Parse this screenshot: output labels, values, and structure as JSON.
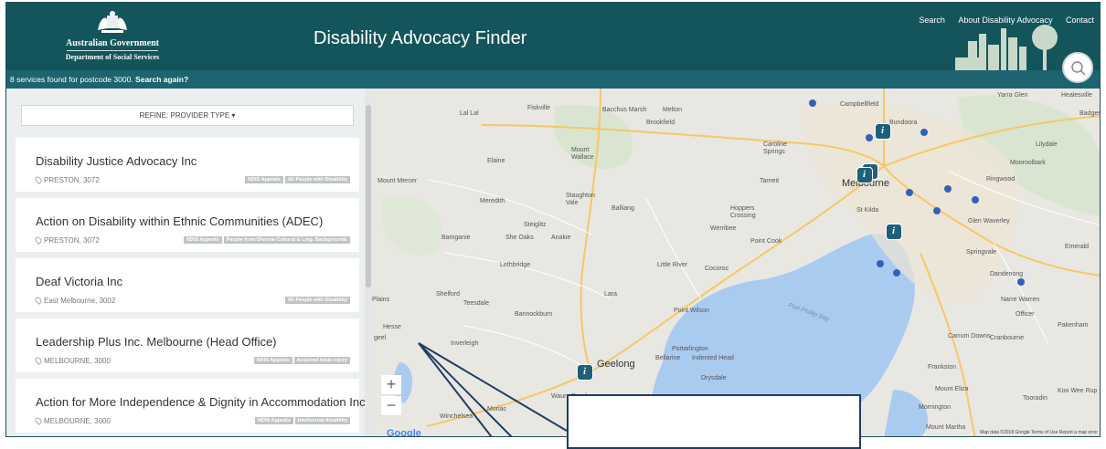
{
  "header": {
    "gov_name": "Australian Government",
    "dept_name": "Department of Social Services",
    "app_title": "Disability Advocacy Finder",
    "links": [
      "Search",
      "About Disability Advocacy",
      "Contact"
    ]
  },
  "status": {
    "found_text": "8 services found for postcode 3000.",
    "search_again": "Search again?"
  },
  "refine": {
    "label": "REFINE: PROVIDER TYPE ▾"
  },
  "services": [
    {
      "name": "Disability Justice Advocacy Inc",
      "location": "PRESTON, 3072",
      "tags": [
        "NDIS Appeals",
        "All People with Disability"
      ]
    },
    {
      "name": "Action on Disability within Ethnic Communities (ADEC)",
      "location": "PRESTON, 3072",
      "tags": [
        "NDIS Appeals",
        "People from Diverse Cultural & Ling. Backgrounds"
      ]
    },
    {
      "name": "Deaf Victoria Inc",
      "location": "East Melbourne, 3002",
      "tags": [
        "All People with Disability"
      ]
    },
    {
      "name": "Leadership Plus Inc. Melbourne (Head Office)",
      "location": "MELBOURNE, 3000",
      "tags": [
        "NDIS Appeals",
        "Acquired brain injury"
      ]
    },
    {
      "name": "Action for More Independence & Dignity in Accommodation Inc",
      "location": "MELBOURNE, 3000",
      "tags": [
        "NDIS Appeals",
        "Intellectual disability"
      ]
    }
  ],
  "map": {
    "places": [
      "Lal Lal",
      "Fiskville",
      "Bacchus Marsh",
      "Melton",
      "Brookfield",
      "Campbellfield",
      "Bundoora",
      "Mount Wallace",
      "Elaine",
      "Caroline Springs",
      "Mount Mercer",
      "Meredith",
      "Staughton Vale",
      "Tarneit",
      "Melbourne",
      "Ringwood",
      "Mooroolbark",
      "Lilydale",
      "Balliang",
      "Hoppers Crossing",
      "St Kilda",
      "Glen Waverley",
      "Steiglitz",
      "She Oaks",
      "Anakie",
      "Werribee",
      "Point Cook",
      "Bamganie",
      "Lethbridge",
      "Little River",
      "Cocoroc",
      "Springvale",
      "Dandenong",
      "Emerald",
      "Shelford",
      "Teesdale",
      "Lara",
      "Point Wilson",
      "Narre Warren",
      "Bannockburn",
      "Port Phillip Bay",
      "Officer",
      "Pakenham",
      "Hesse",
      "Inverleigh",
      "Portarlington",
      "Bellarine",
      "Indented Head",
      "Carrum Downs",
      "Cranbourne",
      "Geelong",
      "Frankston",
      "Drysdale",
      "Waurn Ponds",
      "Moriac",
      "Winchelsea",
      "Mount Eliza",
      "Tooradin",
      "Mornington",
      "Mount Martha",
      "Koo Wee Rup",
      "Plains",
      "geel",
      "Healesville",
      "Yarra Glen",
      "Badger"
    ],
    "zoom_in": "+",
    "zoom_out": "−",
    "google": "Google",
    "attribution": "Map data ©2018 Google   Terms of Use   Report a map error"
  },
  "colors": {
    "header_bg": "#14555c",
    "status_bg": "#1d6470",
    "marker": "#1e5f7a",
    "callout_border": "#1f3c63"
  }
}
